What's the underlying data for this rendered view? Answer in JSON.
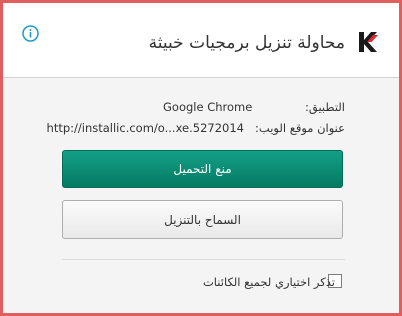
{
  "dialog": {
    "title": "محاولة تنزيل برمجيات خبيثة",
    "info_icon": "info-icon",
    "logo_icon": "kaspersky-logo-icon"
  },
  "details": {
    "application_label": "التطبيق:",
    "application_value": "Google Chrome",
    "url_label": "عنوان موقع الويب:",
    "url_value": "http://installic.com/o...xe.5272014"
  },
  "actions": {
    "block_label": "منع التحميل",
    "allow_label": "السماح بالتنزيل"
  },
  "remember": {
    "label": "تذكر اختياري لجميع الكائنات",
    "checked": false
  },
  "colors": {
    "border": "#e15e5e",
    "primary_button": "#0a8b73",
    "body_background": "#f4f4f4",
    "info_icon": "#1e9bc2"
  }
}
